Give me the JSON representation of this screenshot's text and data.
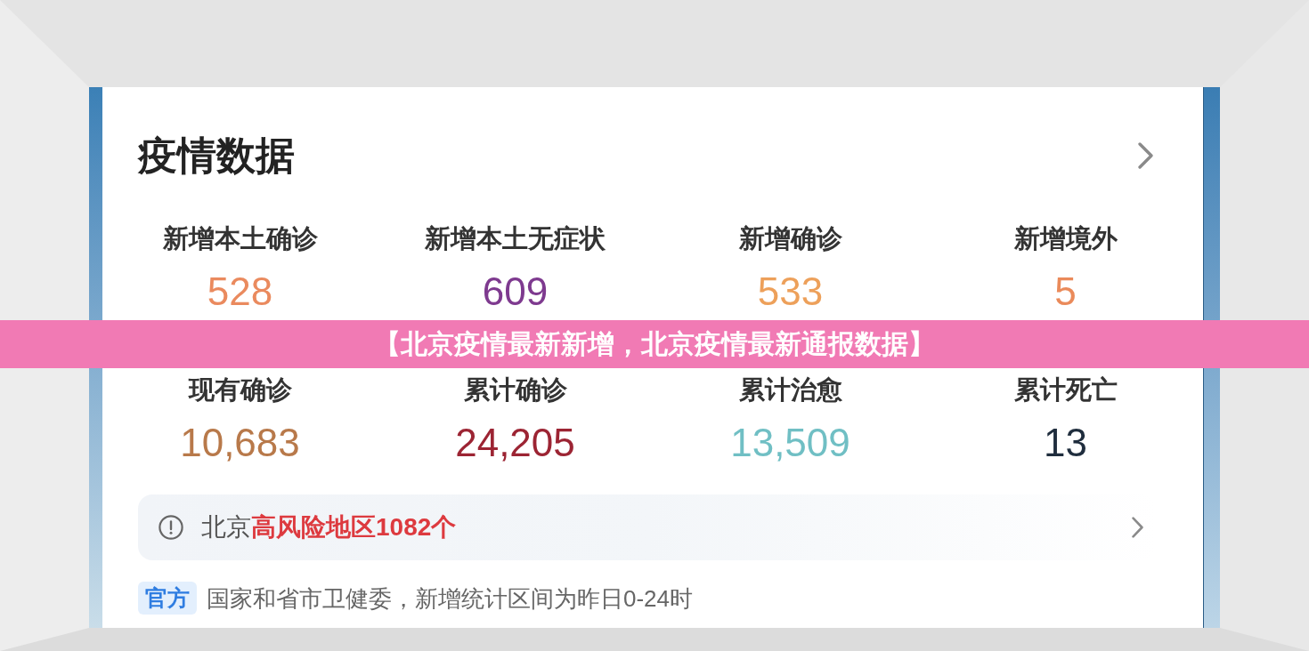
{
  "banner": {
    "title": "【北京疫情最新新增，北京疫情最新通报数据】"
  },
  "card": {
    "title": "疫情数据"
  },
  "stats": [
    {
      "label": "新增本土确诊",
      "value": "528",
      "color": "#ea8a5e"
    },
    {
      "label": "新增本土无症状",
      "value": "609",
      "color": "#7e3a8f"
    },
    {
      "label": "新增确诊",
      "value": "533",
      "color": "#eda05a"
    },
    {
      "label": "新增境外",
      "value": "5",
      "color": "#ea8a5a"
    },
    {
      "label": "现有确诊",
      "value": "10,683",
      "color": "#b8794a"
    },
    {
      "label": "累计确诊",
      "value": "24,205",
      "color": "#9c2433"
    },
    {
      "label": "累计治愈",
      "value": "13,509",
      "color": "#70bfc4"
    },
    {
      "label": "累计死亡",
      "value": "13",
      "color": "#1f2d3d"
    }
  ],
  "alert": {
    "text": "北京**高风险地区1082个**"
  },
  "source": {
    "badge": "官方",
    "text": "国家和省市卫健委，新增统计区间为昨日0-24时"
  }
}
